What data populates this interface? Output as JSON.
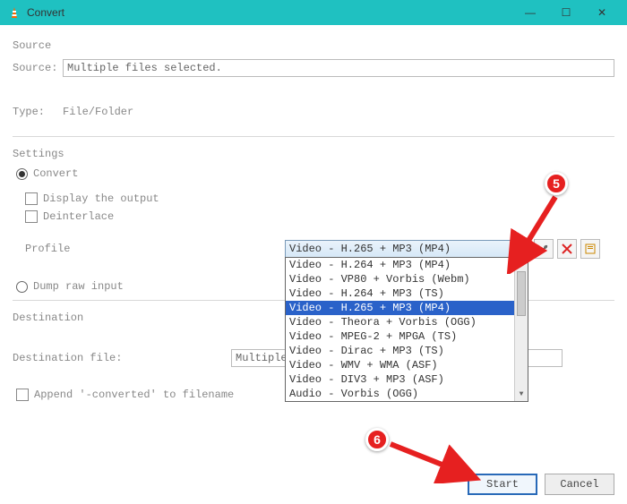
{
  "window": {
    "title": "Convert",
    "min": "—",
    "max": "☐",
    "close": "✕"
  },
  "source": {
    "section_label": "Source",
    "source_label": "Source:",
    "source_value": "Multiple files selected.",
    "type_label": "Type:",
    "type_value": "File/Folder"
  },
  "settings": {
    "section_label": "Settings",
    "convert_label": "Convert",
    "display_output_label": "Display the output",
    "deinterlace_label": "Deinterlace",
    "profile_label": "Profile",
    "combo_selected": "Video - H.265 + MP3 (MP4)",
    "options": [
      "Video - H.264 + MP3 (MP4)",
      "Video - VP80 + Vorbis (Webm)",
      "Video - H.264 + MP3 (TS)",
      "Video - H.265 + MP3 (MP4)",
      "Video - Theora + Vorbis (OGG)",
      "Video - MPEG-2 + MPGA (TS)",
      "Video - Dirac + MP3 (TS)",
      "Video - WMV + WMA (ASF)",
      "Video - DIV3 + MP3 (ASF)",
      "Audio - Vorbis (OGG)"
    ],
    "dump_raw_label": "Dump raw input"
  },
  "destination": {
    "section_label": "Destination",
    "file_label": "Destination file:",
    "file_value": "Multiple Fil",
    "append_label": "Append '-converted' to filename"
  },
  "footer": {
    "start_label": "Start",
    "cancel_label": "Cancel"
  },
  "callouts": {
    "five": "5",
    "six": "6"
  }
}
